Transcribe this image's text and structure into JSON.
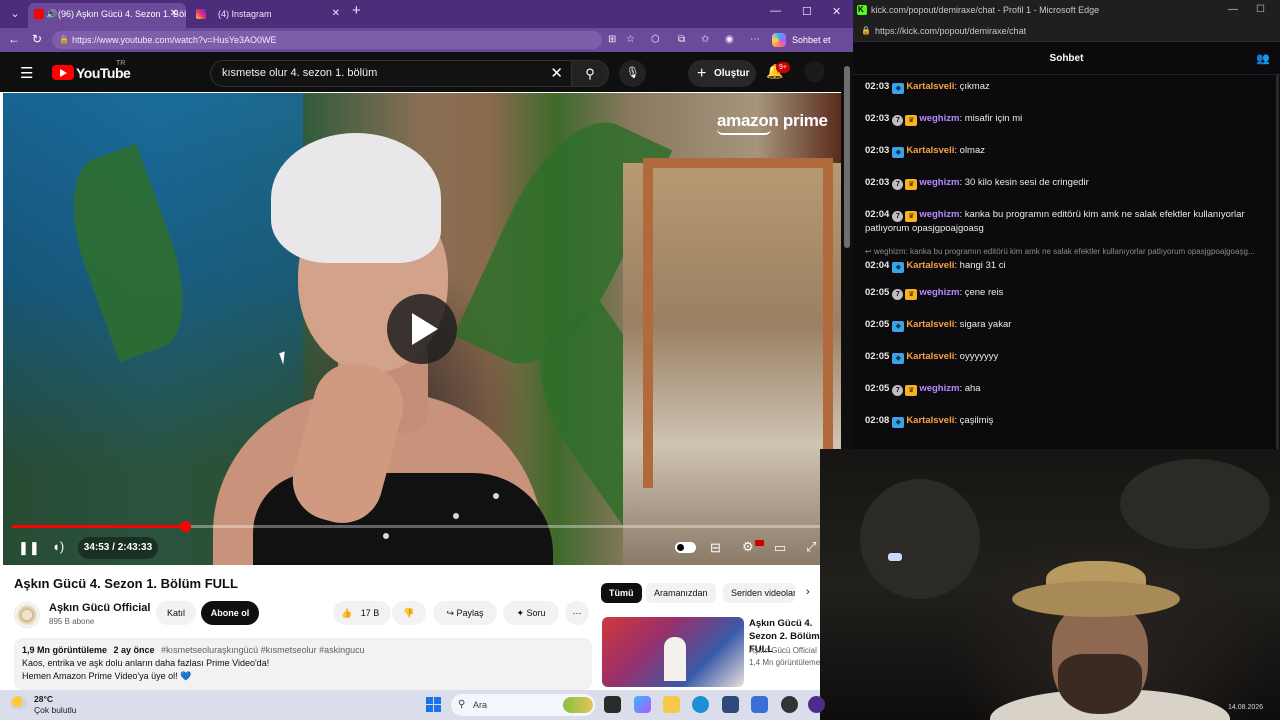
{
  "left_browser": {
    "tabs": [
      {
        "label": "(96) Aşkın Gücü 4. Sezon 1. Bölüm FULL",
        "active": true
      },
      {
        "label": "(4) Instagram",
        "active": false
      }
    ],
    "url": "https://www.youtube.com/watch?v=HusYe3AO0WE",
    "copilot_label": "Sohbet et"
  },
  "youtube": {
    "logo": "YouTube",
    "country": "TR",
    "search_value": "kısmetse olur 4. sezon 1. bölüm",
    "create_label": "Oluştur",
    "notif_count": "9+",
    "watermark": "amazon prime",
    "player": {
      "current_time": "34:53",
      "duration": "2:43:33",
      "time_display": "34:53 / 2:43:33",
      "progress_fraction": 0.214
    },
    "video_title": "Aşkın Gücü 4. Sezon 1. Bölüm FULL",
    "channel_name": "Aşkın Gücü Official",
    "channel_subs": "895 B abone",
    "join_label": "Katıl",
    "subscribe_label": "Abone ol",
    "like_count": "17 B",
    "share_label": "Paylaş",
    "ask_label": "Soru",
    "description": {
      "views": "1,9 Mn görüntüleme",
      "ago": "2 ay önce",
      "tags": "#kısmetseoluraşkıngücü #kısmetseolur #askingucu",
      "line1": "Kaos, entrika ve aşk dolu anların daha fazlası Prime Video'da!",
      "line2": "Hemen Amazon Prime Video'ya üye ol! 💙"
    },
    "rec_chips": [
      "Tümü",
      "Aramanızdan",
      "Seriden videolar"
    ],
    "rec_video": {
      "title": "Aşkın Gücü 4. Sezon 2. Bölüm FULL",
      "channel": "Aşkın Gücü Official",
      "views": "1,4 Mn görüntüleme"
    }
  },
  "right_browser": {
    "title": "kick.com/popout/demiraxe/chat - Profil 1 - Microsoft Edge",
    "url": "https://kick.com/popout/demiraxe/chat",
    "chat_header": "Sohbet",
    "reply_preview": "weghizm: kanka bu programın editörü kim amk ne salak efektler kullanıyorlar patlıyorum opasjgpoajgoaşg...",
    "messages": [
      {
        "time": "02:03",
        "user": "Kartalsveli",
        "sub": false,
        "text": "çıkmaz"
      },
      {
        "time": "02:03",
        "user": "weghizm",
        "sub": true,
        "level": "7",
        "text": "misafir için mi"
      },
      {
        "time": "02:03",
        "user": "Kartalsveli",
        "sub": false,
        "text": "olmaz"
      },
      {
        "time": "02:03",
        "user": "weghizm",
        "sub": true,
        "level": "7",
        "text": "30 kilo kesin sesi de cringedir"
      },
      {
        "time": "02:04",
        "user": "weghizm",
        "sub": true,
        "level": "7",
        "text": "kanka bu programın editörü kim amk ne salak efektler kullanıyorlar patlıyorum opasjgpoajgoasg"
      },
      {
        "time": "02:04",
        "user": "Kartalsveli",
        "sub": false,
        "text": "hangi 31 ci"
      },
      {
        "time": "02:05",
        "user": "weghizm",
        "sub": true,
        "level": "7",
        "text": "çene reis"
      },
      {
        "time": "02:05",
        "user": "Kartalsveli",
        "sub": false,
        "text": "sigara yakar"
      },
      {
        "time": "02:05",
        "user": "Kartalsveli",
        "sub": false,
        "text": "oyyyyyyy"
      },
      {
        "time": "02:05",
        "user": "weghizm",
        "sub": true,
        "level": "7",
        "text": "aha"
      },
      {
        "time": "02:08",
        "user": "Kartalsveli",
        "sub": false,
        "text": "çaşilmiş"
      }
    ]
  },
  "taskbar": {
    "temp": "28°C",
    "weather": "Çok bulutlu",
    "search_placeholder": "Ara",
    "date": "14.08.2026"
  }
}
